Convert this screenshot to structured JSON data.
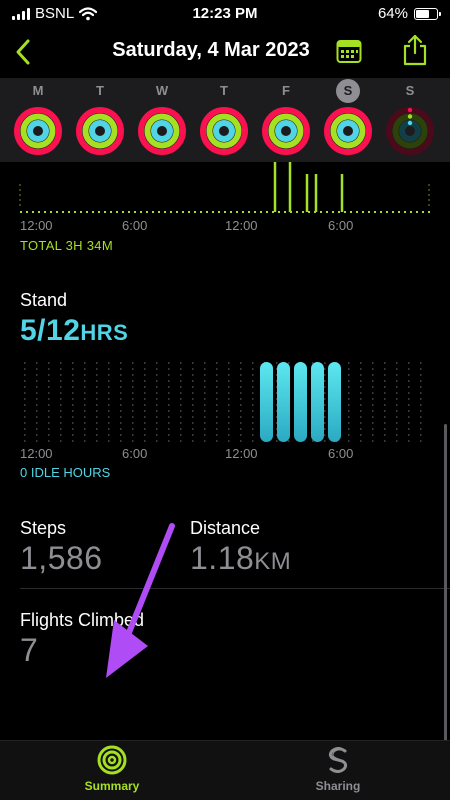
{
  "status": {
    "carrier": "BSNL",
    "time": "12:23 PM",
    "battery": "64%",
    "battery_level": 0.64
  },
  "nav": {
    "title": "Saturday, 4 Mar 2023"
  },
  "week": {
    "days": [
      {
        "label": "M"
      },
      {
        "label": "T"
      },
      {
        "label": "W"
      },
      {
        "label": "T"
      },
      {
        "label": "F"
      },
      {
        "label": "S",
        "selected": true
      },
      {
        "label": "S"
      }
    ]
  },
  "exercise": {
    "ticks": [
      "12:00",
      "6:00",
      "12:00",
      "6:00"
    ],
    "total": "TOTAL 3H 34M"
  },
  "stand": {
    "title": "Stand",
    "value": "5/12",
    "unit": "HRS",
    "ticks": [
      "12:00",
      "6:00",
      "12:00",
      "6:00"
    ],
    "idle": "0 IDLE HOURS"
  },
  "steps": {
    "label": "Steps",
    "value": "1,586"
  },
  "distance": {
    "label": "Distance",
    "value": "1.18",
    "unit": "KM"
  },
  "flights": {
    "label": "Flights Climbed",
    "value": "7"
  },
  "tabs": [
    {
      "label": "Summary",
      "active": true
    },
    {
      "label": "Sharing",
      "active": false
    }
  ],
  "colors": {
    "move": "#fa114f",
    "exercise": "#a5e022",
    "stand": "#51d4e5",
    "annotation_arrow": "#b04cf5"
  }
}
